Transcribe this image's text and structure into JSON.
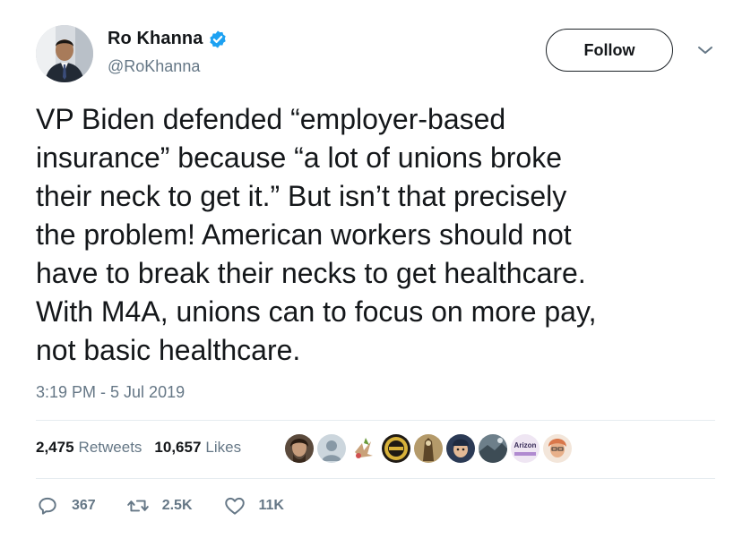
{
  "author": {
    "display_name": "Ro Khanna",
    "handle": "@RoKhanna",
    "verified": true
  },
  "follow_button": {
    "label": "Follow"
  },
  "tweet": {
    "lines": [
      "VP Biden defended “employer-based",
      "insurance” because “a lot of unions broke",
      "their neck to get it.” But isn’t that precisely",
      "the problem! American workers should not",
      "have to break their necks to get healthcare.",
      "With M4A, unions can to focus on more pay,",
      "not basic healthcare."
    ],
    "timestamp": "3:19 PM - 5 Jul 2019"
  },
  "stats": {
    "retweets": {
      "count": "2,475",
      "label": "Retweets"
    },
    "likes": {
      "count": "10,657",
      "label": "Likes"
    }
  },
  "likers": [
    {
      "icon": "user-avatar-1",
      "color": "#5b4a3c"
    },
    {
      "icon": "default-avatar",
      "color": "#aab8c2"
    },
    {
      "icon": "user-avatar-3",
      "color": "#e9e2d5"
    },
    {
      "icon": "user-avatar-4",
      "color": "#1f1a14"
    },
    {
      "icon": "user-avatar-5",
      "color": "#b49a6a"
    },
    {
      "icon": "user-avatar-6",
      "color": "#2b3a55"
    },
    {
      "icon": "user-avatar-7",
      "color": "#6d7f8a"
    },
    {
      "icon": "user-avatar-8",
      "color": "#efe6f3",
      "text": "Arizon"
    },
    {
      "icon": "user-avatar-9",
      "color": "#d9774a"
    }
  ],
  "actions": {
    "reply": {
      "icon": "reply-icon",
      "count": "367"
    },
    "retweet": {
      "icon": "retweet-icon",
      "count": "2.5K"
    },
    "like": {
      "icon": "heart-icon",
      "count": "11K"
    }
  },
  "colors": {
    "text": "#14171a",
    "secondary": "#657786",
    "verified": "#1da1f2",
    "divider": "#e6ecf0"
  }
}
